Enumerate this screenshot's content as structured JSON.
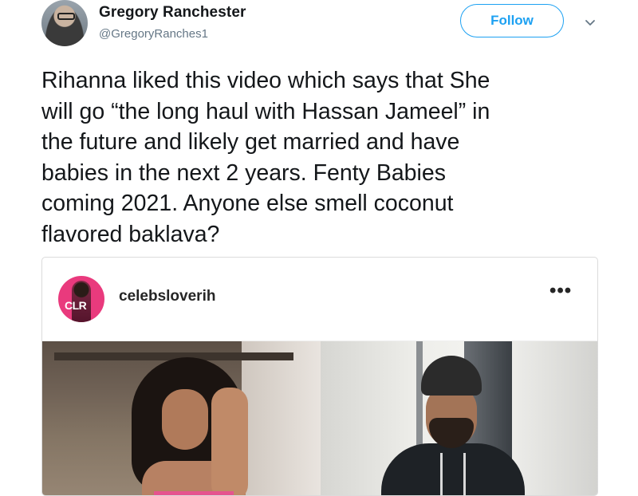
{
  "user": {
    "name": "Gregory Ranchester",
    "handle": "@GregoryRanches1"
  },
  "follow_button": {
    "label": "Follow"
  },
  "tweet": {
    "text": "Rihanna liked this video which says that She\nwill go “the long haul with Hassan Jameel” in\nthe future and likely get married and have\nbabies in the next 2 years. Fenty Babies\ncoming 2021. Anyone else smell coconut\nflavored baklava?"
  },
  "embed": {
    "avatar_text": "CLR",
    "username": "celebsloverih",
    "more_label": "•••"
  },
  "icons": {
    "chevron": "chevron-down-icon",
    "more": "more-options-icon"
  },
  "colors": {
    "accent": "#1da1f2",
    "ig_avatar": "#e93a7d",
    "text": "#14171a",
    "secondary": "#657786"
  }
}
